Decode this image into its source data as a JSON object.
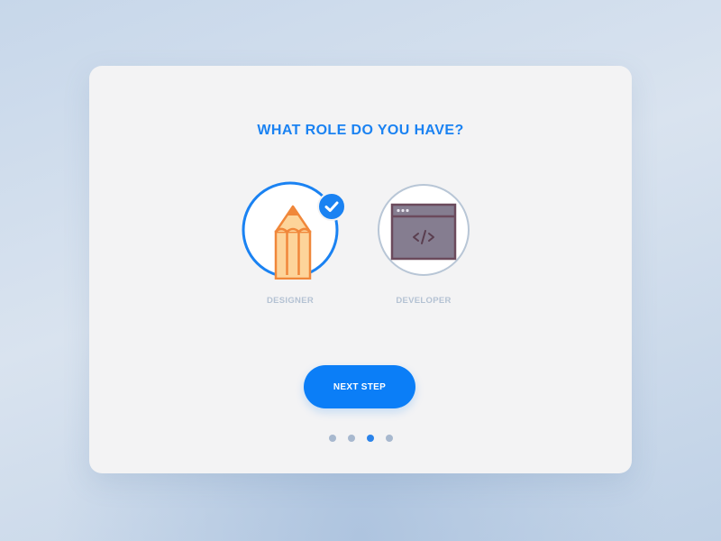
{
  "heading": "WHAT ROLE DO YOU HAVE?",
  "roles": [
    {
      "label": "DESIGNER",
      "icon": "pencil-icon",
      "selected": true
    },
    {
      "label": "DEVELOPER",
      "icon": "code-window-icon",
      "selected": false
    }
  ],
  "next_button_label": "NEXT STEP",
  "pagination": {
    "total": 4,
    "active": 3
  },
  "colors": {
    "accent": "#1a82f2",
    "button": "#0b7ef7",
    "card": "#f3f3f4",
    "muted_label": "#b4c2d3",
    "pencil_orange": "#f0873a",
    "pencil_body": "#fdd49a",
    "window_frame": "#6b4a5c",
    "window_fill": "#857d90"
  }
}
